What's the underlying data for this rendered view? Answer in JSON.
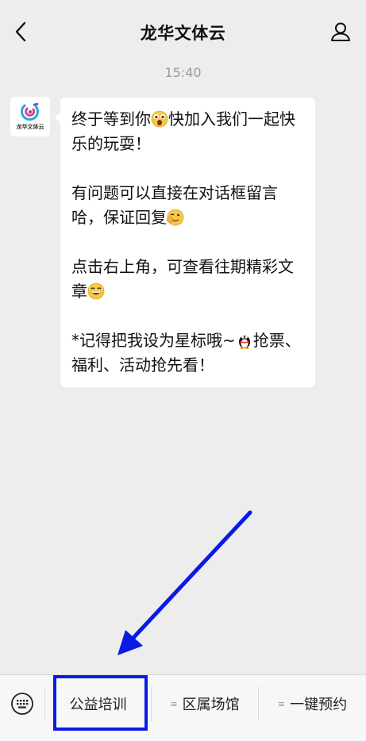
{
  "header": {
    "title": "龙华文体云",
    "back_icon": "chevron-left-icon",
    "profile_icon": "person-icon"
  },
  "chat": {
    "timestamp": "15:40",
    "avatar": {
      "logo_text": "龙华文体云",
      "icon": "logo-icon"
    },
    "message": {
      "p1_a": "终于等到你",
      "p1_b": "快加入我们一起快乐的玩耍！",
      "p2_a": "有问题可以直接在对话框留言哈，保证回复",
      "p3_a": "点击右上角，可查看往期精彩文章",
      "p4_a": "*记得把我设为星标哦~",
      "p4_b": "抢票、福利、活动抢先看！"
    }
  },
  "menu": {
    "keyboard_icon": "keyboard-icon",
    "items": [
      {
        "label": "公益培训"
      },
      {
        "label": "区属场馆"
      },
      {
        "label": "一键预约"
      }
    ],
    "submenu_icon": "≡"
  },
  "annotation": {
    "color": "#0a1ae6"
  }
}
